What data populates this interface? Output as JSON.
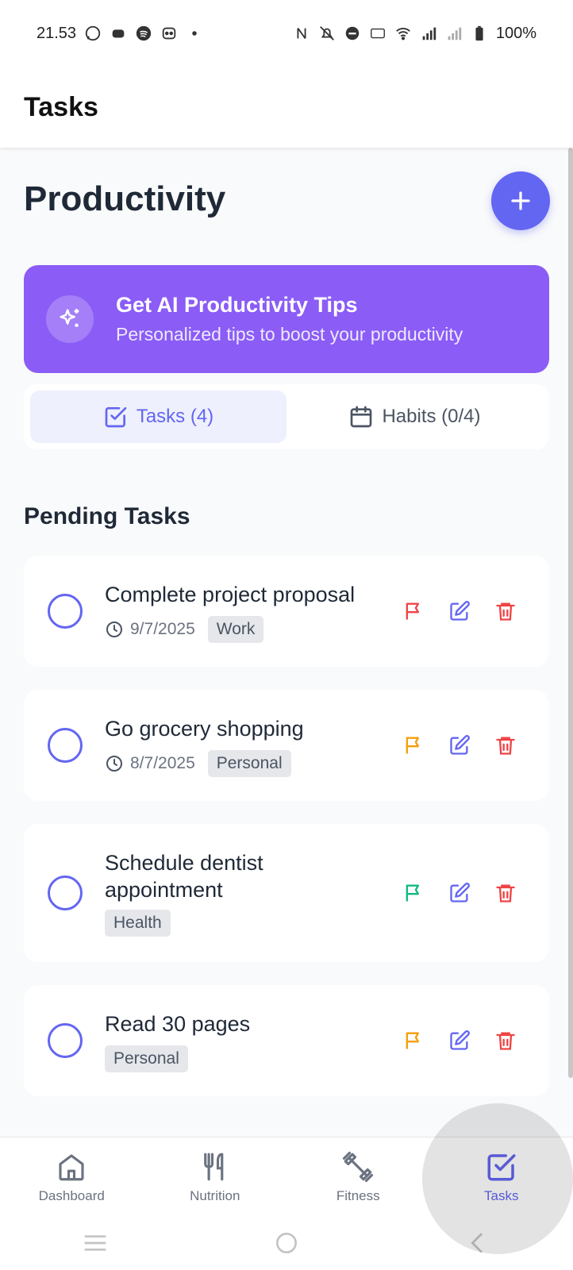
{
  "status_bar": {
    "time": "21.53",
    "battery": "100%"
  },
  "header": {
    "title": "Tasks"
  },
  "main": {
    "page_title": "Productivity",
    "ai_banner": {
      "title": "Get AI Productivity Tips",
      "subtitle": "Personalized tips to boost your productivity"
    },
    "tabs": [
      {
        "label": "Tasks (4)",
        "icon": "check-square-icon",
        "active": true
      },
      {
        "label": "Habits (0/4)",
        "icon": "calendar-icon",
        "active": false
      }
    ],
    "section_title": "Pending Tasks",
    "tasks": [
      {
        "title": "Complete project proposal",
        "date": "9/7/2025",
        "tags": [
          "Work"
        ],
        "priority_color": "#ef4444"
      },
      {
        "title": "Go grocery shopping",
        "date": "8/7/2025",
        "tags": [
          "Personal"
        ],
        "priority_color": "#f59e0b"
      },
      {
        "title": "Schedule dentist appointment",
        "date": "",
        "tags": [
          "Health"
        ],
        "priority_color": "#10b981"
      },
      {
        "title": "Read 30 pages",
        "date": "",
        "tags": [
          "Personal"
        ],
        "priority_color": "#f59e0b"
      }
    ]
  },
  "bottom_nav": {
    "items": [
      {
        "label": "Dashboard",
        "icon": "home-icon",
        "active": false
      },
      {
        "label": "Nutrition",
        "icon": "utensils-icon",
        "active": false
      },
      {
        "label": "Fitness",
        "icon": "dumbbell-icon",
        "active": false
      },
      {
        "label": "Tasks",
        "icon": "check-square-icon",
        "active": true
      }
    ]
  },
  "colors": {
    "accent": "#6366f1",
    "banner": "#8b5cf6",
    "edit": "#6366f1",
    "delete": "#ef4444"
  }
}
